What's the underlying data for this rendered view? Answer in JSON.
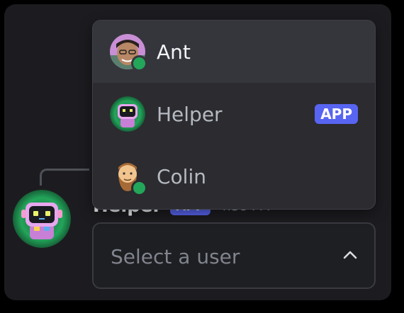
{
  "message": {
    "author": "Helper",
    "badge": "APP",
    "time": "4:38 PM"
  },
  "select": {
    "placeholder": "Select a user",
    "icon": "chevron-up-icon"
  },
  "options": [
    {
      "label": "Ant",
      "status": "online",
      "avatar": "ant-avatar"
    },
    {
      "label": "Helper",
      "badge": "APP",
      "avatar": "robot-avatar"
    },
    {
      "label": "Colin",
      "status": "online",
      "avatar": "bearded-man-avatar"
    }
  ],
  "colors": {
    "accent": "#5865f2",
    "online": "#23a55a",
    "panel": "#1c1c20",
    "dropdown": "#2b2b30"
  }
}
